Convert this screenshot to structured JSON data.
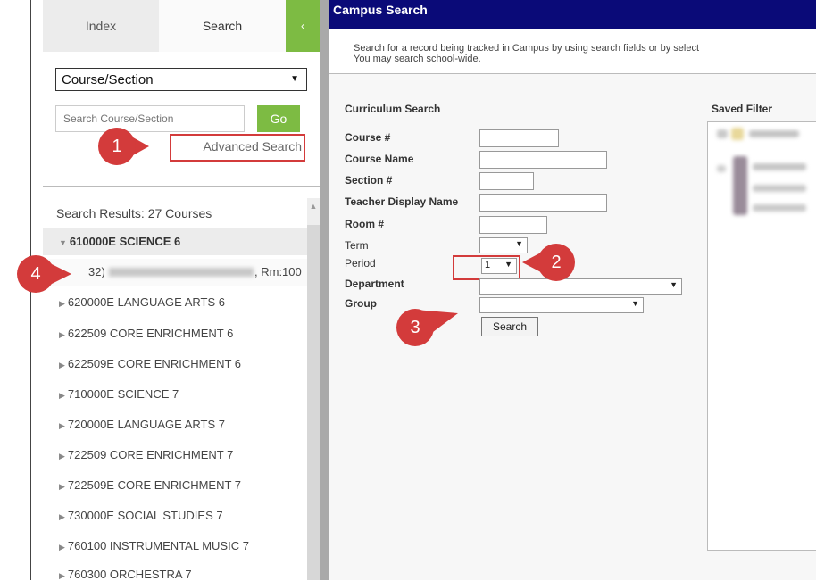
{
  "left_panel": {
    "tabs": [
      {
        "label": "Index"
      },
      {
        "label": "Search"
      }
    ],
    "collapse_glyph": "‹",
    "type_select": {
      "value": "Course/Section"
    },
    "search": {
      "placeholder": "Search Course/Section",
      "go_label": "Go"
    },
    "advanced_search_label": "Advanced Search",
    "results_title": "Search Results: 27 Courses",
    "courses": [
      {
        "label": "610000E SCIENCE 6",
        "expanded": true
      },
      {
        "label": "620000E LANGUAGE ARTS 6"
      },
      {
        "label": "622509 CORE ENRICHMENT 6"
      },
      {
        "label": "622509E CORE ENRICHMENT 6"
      },
      {
        "label": "710000E SCIENCE 7"
      },
      {
        "label": "720000E LANGUAGE ARTS 7"
      },
      {
        "label": "722509 CORE ENRICHMENT 7"
      },
      {
        "label": "722509E CORE ENRICHMENT 7"
      },
      {
        "label": "730000E SOCIAL STUDIES 7"
      },
      {
        "label": "760100 INSTRUMENTAL MUSIC 7"
      },
      {
        "label": "760300 ORCHESTRA 7"
      }
    ],
    "section_row": {
      "prefix": "32)",
      "suffix": ", Rm:100"
    }
  },
  "callouts": [
    "1",
    "2",
    "3",
    "4"
  ],
  "right_panel": {
    "title": "Campus Search",
    "description_line1": "Search for a record being tracked in Campus by using search fields or by select",
    "description_line2": "You may search school-wide.",
    "curriculum_title": "Curriculum Search",
    "fields": {
      "course_num": "Course #",
      "course_name": "Course Name",
      "section_num": "Section #",
      "teacher": "Teacher Display Name",
      "room": "Room #",
      "term": "Term",
      "period": "Period",
      "department": "Department",
      "group": "Group"
    },
    "period_value": "1",
    "search_button": "Search",
    "saved_filter_title": "Saved Filter"
  },
  "colors": {
    "title_bar": "#0a0a78",
    "accent_green": "#7dbb43",
    "callout_red": "#d33b3b"
  }
}
